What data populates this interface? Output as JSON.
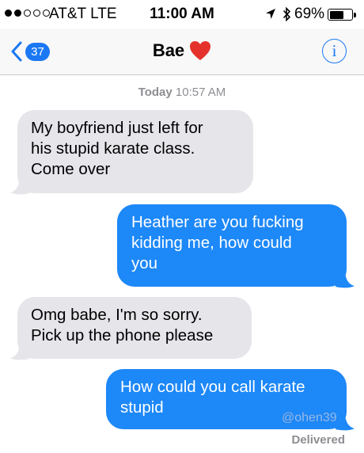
{
  "status_bar": {
    "carrier": "AT&T  LTE",
    "time": "11:00 AM",
    "battery": "69%",
    "battery_level": 0.69,
    "signal_bars_filled": 2,
    "signal_bars_total": 5
  },
  "nav": {
    "back_count": "37",
    "contact_name": "Bae",
    "contact_emoji": "heart",
    "info_glyph": "i"
  },
  "timestamp": {
    "day": "Today",
    "time": "10:57 AM"
  },
  "messages": [
    {
      "direction": "received",
      "lines": [
        "My boyfriend just left for",
        "his stupid karate class.",
        "Come over"
      ]
    },
    {
      "direction": "sent",
      "lines": [
        "Heather are you fucking",
        "kidding me, how could",
        "you"
      ]
    },
    {
      "direction": "received",
      "lines": [
        "Omg babe, I'm so sorry.",
        "Pick up the phone please"
      ]
    },
    {
      "direction": "sent",
      "lines": [
        "How could you call karate",
        "stupid"
      ]
    }
  ],
  "watermark": "@ohen39",
  "delivered": "Delivered",
  "colors": {
    "sent_bubble": "#1d88f7",
    "received_bubble": "#e5e5ea",
    "accent": "#1a78f2",
    "heart": "#e5312b"
  }
}
